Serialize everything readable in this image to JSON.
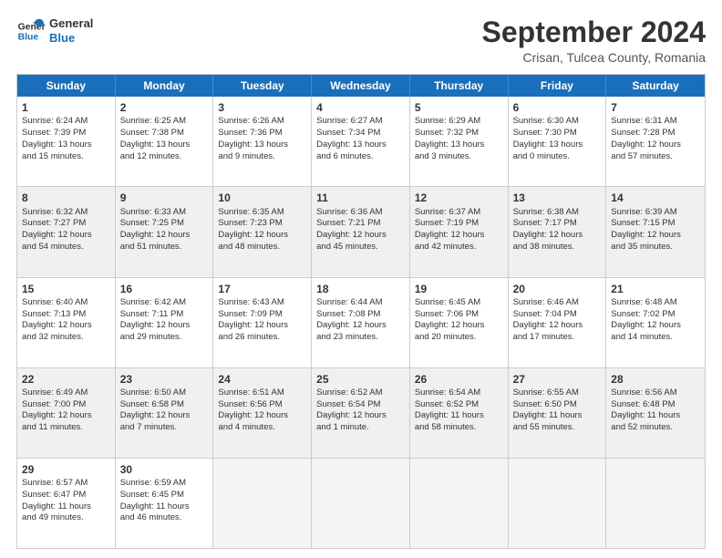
{
  "logo": {
    "line1": "General",
    "line2": "Blue"
  },
  "title": "September 2024",
  "subtitle": "Crisan, Tulcea County, Romania",
  "days": [
    "Sunday",
    "Monday",
    "Tuesday",
    "Wednesday",
    "Thursday",
    "Friday",
    "Saturday"
  ],
  "weeks": [
    [
      {
        "day": "1",
        "lines": [
          "Sunrise: 6:24 AM",
          "Sunset: 7:39 PM",
          "Daylight: 13 hours",
          "and 15 minutes."
        ]
      },
      {
        "day": "2",
        "lines": [
          "Sunrise: 6:25 AM",
          "Sunset: 7:38 PM",
          "Daylight: 13 hours",
          "and 12 minutes."
        ]
      },
      {
        "day": "3",
        "lines": [
          "Sunrise: 6:26 AM",
          "Sunset: 7:36 PM",
          "Daylight: 13 hours",
          "and 9 minutes."
        ]
      },
      {
        "day": "4",
        "lines": [
          "Sunrise: 6:27 AM",
          "Sunset: 7:34 PM",
          "Daylight: 13 hours",
          "and 6 minutes."
        ]
      },
      {
        "day": "5",
        "lines": [
          "Sunrise: 6:29 AM",
          "Sunset: 7:32 PM",
          "Daylight: 13 hours",
          "and 3 minutes."
        ]
      },
      {
        "day": "6",
        "lines": [
          "Sunrise: 6:30 AM",
          "Sunset: 7:30 PM",
          "Daylight: 13 hours",
          "and 0 minutes."
        ]
      },
      {
        "day": "7",
        "lines": [
          "Sunrise: 6:31 AM",
          "Sunset: 7:28 PM",
          "Daylight: 12 hours",
          "and 57 minutes."
        ]
      }
    ],
    [
      {
        "day": "8",
        "lines": [
          "Sunrise: 6:32 AM",
          "Sunset: 7:27 PM",
          "Daylight: 12 hours",
          "and 54 minutes."
        ]
      },
      {
        "day": "9",
        "lines": [
          "Sunrise: 6:33 AM",
          "Sunset: 7:25 PM",
          "Daylight: 12 hours",
          "and 51 minutes."
        ]
      },
      {
        "day": "10",
        "lines": [
          "Sunrise: 6:35 AM",
          "Sunset: 7:23 PM",
          "Daylight: 12 hours",
          "and 48 minutes."
        ]
      },
      {
        "day": "11",
        "lines": [
          "Sunrise: 6:36 AM",
          "Sunset: 7:21 PM",
          "Daylight: 12 hours",
          "and 45 minutes."
        ]
      },
      {
        "day": "12",
        "lines": [
          "Sunrise: 6:37 AM",
          "Sunset: 7:19 PM",
          "Daylight: 12 hours",
          "and 42 minutes."
        ]
      },
      {
        "day": "13",
        "lines": [
          "Sunrise: 6:38 AM",
          "Sunset: 7:17 PM",
          "Daylight: 12 hours",
          "and 38 minutes."
        ]
      },
      {
        "day": "14",
        "lines": [
          "Sunrise: 6:39 AM",
          "Sunset: 7:15 PM",
          "Daylight: 12 hours",
          "and 35 minutes."
        ]
      }
    ],
    [
      {
        "day": "15",
        "lines": [
          "Sunrise: 6:40 AM",
          "Sunset: 7:13 PM",
          "Daylight: 12 hours",
          "and 32 minutes."
        ]
      },
      {
        "day": "16",
        "lines": [
          "Sunrise: 6:42 AM",
          "Sunset: 7:11 PM",
          "Daylight: 12 hours",
          "and 29 minutes."
        ]
      },
      {
        "day": "17",
        "lines": [
          "Sunrise: 6:43 AM",
          "Sunset: 7:09 PM",
          "Daylight: 12 hours",
          "and 26 minutes."
        ]
      },
      {
        "day": "18",
        "lines": [
          "Sunrise: 6:44 AM",
          "Sunset: 7:08 PM",
          "Daylight: 12 hours",
          "and 23 minutes."
        ]
      },
      {
        "day": "19",
        "lines": [
          "Sunrise: 6:45 AM",
          "Sunset: 7:06 PM",
          "Daylight: 12 hours",
          "and 20 minutes."
        ]
      },
      {
        "day": "20",
        "lines": [
          "Sunrise: 6:46 AM",
          "Sunset: 7:04 PM",
          "Daylight: 12 hours",
          "and 17 minutes."
        ]
      },
      {
        "day": "21",
        "lines": [
          "Sunrise: 6:48 AM",
          "Sunset: 7:02 PM",
          "Daylight: 12 hours",
          "and 14 minutes."
        ]
      }
    ],
    [
      {
        "day": "22",
        "lines": [
          "Sunrise: 6:49 AM",
          "Sunset: 7:00 PM",
          "Daylight: 12 hours",
          "and 11 minutes."
        ]
      },
      {
        "day": "23",
        "lines": [
          "Sunrise: 6:50 AM",
          "Sunset: 6:58 PM",
          "Daylight: 12 hours",
          "and 7 minutes."
        ]
      },
      {
        "day": "24",
        "lines": [
          "Sunrise: 6:51 AM",
          "Sunset: 6:56 PM",
          "Daylight: 12 hours",
          "and 4 minutes."
        ]
      },
      {
        "day": "25",
        "lines": [
          "Sunrise: 6:52 AM",
          "Sunset: 6:54 PM",
          "Daylight: 12 hours",
          "and 1 minute."
        ]
      },
      {
        "day": "26",
        "lines": [
          "Sunrise: 6:54 AM",
          "Sunset: 6:52 PM",
          "Daylight: 11 hours",
          "and 58 minutes."
        ]
      },
      {
        "day": "27",
        "lines": [
          "Sunrise: 6:55 AM",
          "Sunset: 6:50 PM",
          "Daylight: 11 hours",
          "and 55 minutes."
        ]
      },
      {
        "day": "28",
        "lines": [
          "Sunrise: 6:56 AM",
          "Sunset: 6:48 PM",
          "Daylight: 11 hours",
          "and 52 minutes."
        ]
      }
    ],
    [
      {
        "day": "29",
        "lines": [
          "Sunrise: 6:57 AM",
          "Sunset: 6:47 PM",
          "Daylight: 11 hours",
          "and 49 minutes."
        ]
      },
      {
        "day": "30",
        "lines": [
          "Sunrise: 6:59 AM",
          "Sunset: 6:45 PM",
          "Daylight: 11 hours",
          "and 46 minutes."
        ]
      },
      {
        "day": "",
        "lines": []
      },
      {
        "day": "",
        "lines": []
      },
      {
        "day": "",
        "lines": []
      },
      {
        "day": "",
        "lines": []
      },
      {
        "day": "",
        "lines": []
      }
    ]
  ]
}
